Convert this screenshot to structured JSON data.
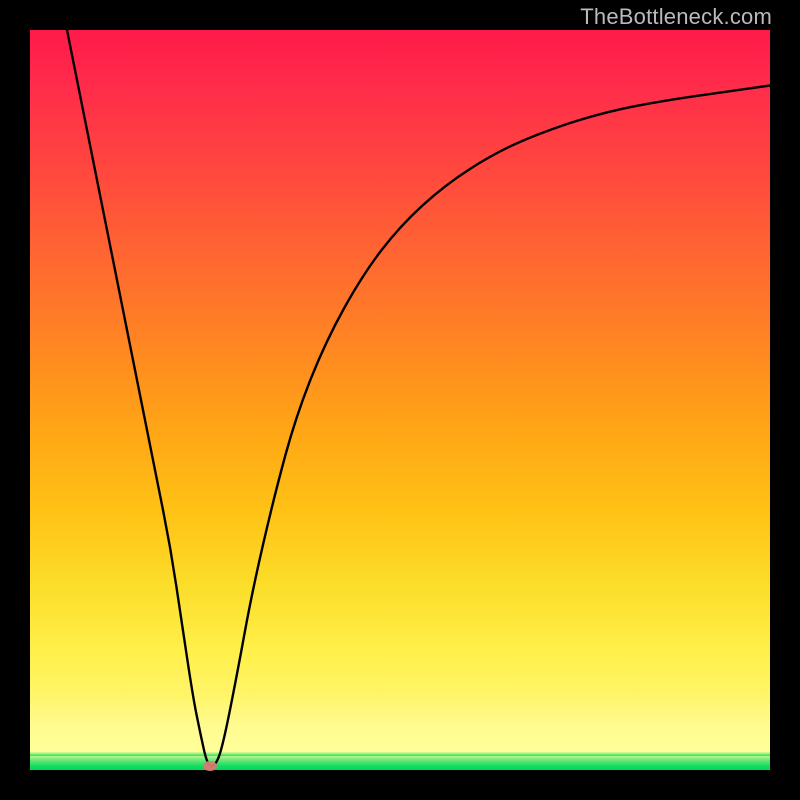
{
  "watermark": "TheBottleneck.com",
  "colors": {
    "frame": "#000000",
    "grad_top": "#ff1a4a",
    "grad_mid": "#fcdd2a",
    "grad_green": "#00e060",
    "curve": "#000000",
    "marker": "#d97b72"
  },
  "chart_data": {
    "type": "line",
    "title": "",
    "xlabel": "",
    "ylabel": "",
    "xlim": [
      0,
      100
    ],
    "ylim": [
      0,
      100
    ],
    "grid": false,
    "curve_points": [
      {
        "x": 5.0,
        "y": 100.0
      },
      {
        "x": 7.0,
        "y": 90.0
      },
      {
        "x": 9.0,
        "y": 80.0
      },
      {
        "x": 11.0,
        "y": 70.0
      },
      {
        "x": 13.0,
        "y": 60.0
      },
      {
        "x": 15.0,
        "y": 50.0
      },
      {
        "x": 17.0,
        "y": 40.0
      },
      {
        "x": 19.0,
        "y": 30.0
      },
      {
        "x": 20.5,
        "y": 20.0
      },
      {
        "x": 22.0,
        "y": 10.0
      },
      {
        "x": 23.0,
        "y": 5.0
      },
      {
        "x": 24.0,
        "y": 0.5
      },
      {
        "x": 25.0,
        "y": 0.5
      },
      {
        "x": 26.0,
        "y": 3.0
      },
      {
        "x": 28.0,
        "y": 13.0
      },
      {
        "x": 30.0,
        "y": 24.0
      },
      {
        "x": 33.0,
        "y": 37.0
      },
      {
        "x": 36.0,
        "y": 48.0
      },
      {
        "x": 40.0,
        "y": 58.0
      },
      {
        "x": 45.0,
        "y": 67.0
      },
      {
        "x": 50.0,
        "y": 73.5
      },
      {
        "x": 56.0,
        "y": 79.0
      },
      {
        "x": 63.0,
        "y": 83.5
      },
      {
        "x": 70.0,
        "y": 86.5
      },
      {
        "x": 78.0,
        "y": 89.0
      },
      {
        "x": 86.0,
        "y": 90.5
      },
      {
        "x": 93.0,
        "y": 91.5
      },
      {
        "x": 100.0,
        "y": 92.5
      }
    ],
    "minimum_marker": {
      "x": 24.3,
      "y": 0.5
    }
  }
}
